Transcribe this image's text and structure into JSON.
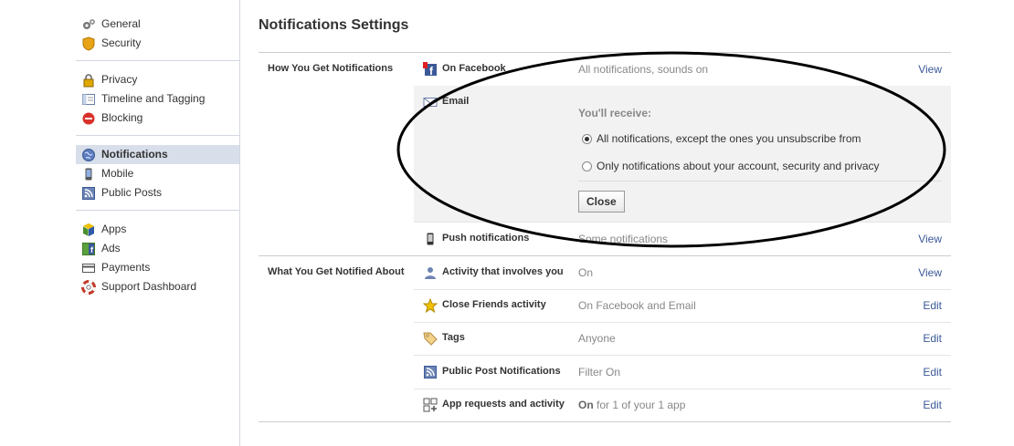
{
  "sidebar": {
    "groups": [
      [
        {
          "label": "General",
          "icon": "gear-icon"
        },
        {
          "label": "Security",
          "icon": "shield-icon"
        }
      ],
      [
        {
          "label": "Privacy",
          "icon": "lock-icon"
        },
        {
          "label": "Timeline and Tagging",
          "icon": "timeline-icon"
        },
        {
          "label": "Blocking",
          "icon": "blocking-icon"
        }
      ],
      [
        {
          "label": "Notifications",
          "icon": "globe-icon",
          "active": true
        },
        {
          "label": "Mobile",
          "icon": "mobile-icon"
        },
        {
          "label": "Public Posts",
          "icon": "rss-icon"
        }
      ],
      [
        {
          "label": "Apps",
          "icon": "apps-cube-icon"
        },
        {
          "label": "Ads",
          "icon": "ads-icon"
        },
        {
          "label": "Payments",
          "icon": "credit-card-icon"
        },
        {
          "label": "Support Dashboard",
          "icon": "lifebuoy-icon"
        }
      ]
    ]
  },
  "main": {
    "title": "Notifications Settings",
    "how_section": {
      "label": "How You Get Notifications",
      "on_facebook": {
        "name": "On Facebook",
        "value": "All notifications, sounds on",
        "action": "View"
      },
      "email": {
        "name": "Email",
        "receive_label": "You'll receive:",
        "option_all": "All notifications, except the ones you unsubscribe from",
        "option_account": "Only notifications about your account, security and privacy",
        "close": "Close"
      },
      "push": {
        "name": "Push notifications",
        "value": "Some notifications",
        "action": "View"
      }
    },
    "what_section": {
      "label": "What You Get Notified About",
      "activity": {
        "name": "Activity that involves you",
        "value": "On",
        "action": "View"
      },
      "close_friends": {
        "name": "Close Friends activity",
        "value": "On Facebook and Email",
        "action": "Edit"
      },
      "tags": {
        "name": "Tags",
        "value": "Anyone",
        "action": "Edit"
      },
      "public_post": {
        "name": "Public Post Notifications",
        "value": "Filter On",
        "action": "Edit"
      },
      "app_requests": {
        "name": "App requests and activity",
        "value_strong": "On",
        "value_rest": " for 1 of your 1 app",
        "action": "Edit"
      }
    }
  },
  "colors": {
    "link": "#3b5998",
    "active_bg": "#d8dfea",
    "panel_bg": "#f2f2f2"
  }
}
